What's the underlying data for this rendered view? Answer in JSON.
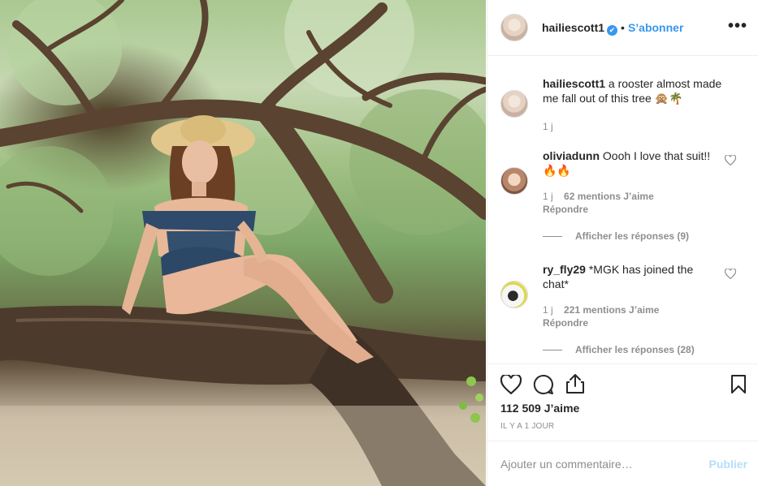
{
  "post": {
    "username": "hailiescott1",
    "verified_mark": "✔",
    "separator": "•",
    "follow_label": "S’abonner",
    "more_label": "•••"
  },
  "caption": {
    "username": "hailiescott1",
    "text": "a rooster almost made me fall out of this tree 🙊🌴",
    "time": "1 j"
  },
  "comments": [
    {
      "username": "oliviadunn",
      "text": "Oooh I love that suit!! 🔥🔥",
      "time": "1 j",
      "likes": "62 mentions J’aime",
      "reply_label": "Répondre",
      "show_replies": "Afficher les réponses (9)"
    },
    {
      "username": "ry_fly29",
      "text": "*MGK has joined the chat*",
      "time": "1 j",
      "likes": "221 mentions J’aime",
      "reply_label": "Répondre",
      "show_replies": "Afficher les réponses (28)"
    }
  ],
  "actions": {
    "icons": [
      "heart-icon",
      "comment-icon",
      "share-icon",
      "bookmark-icon"
    ],
    "likes_count": "112 509 J’aime",
    "posted_time": "IL Y A 1 JOUR"
  },
  "composer": {
    "placeholder": "Ajouter un commentaire…",
    "publish_label": "Publier"
  },
  "colors": {
    "accent": "#3897f0",
    "muted": "#8e8e8e",
    "text": "#262626",
    "publish_disabled": "#b2dffc"
  }
}
